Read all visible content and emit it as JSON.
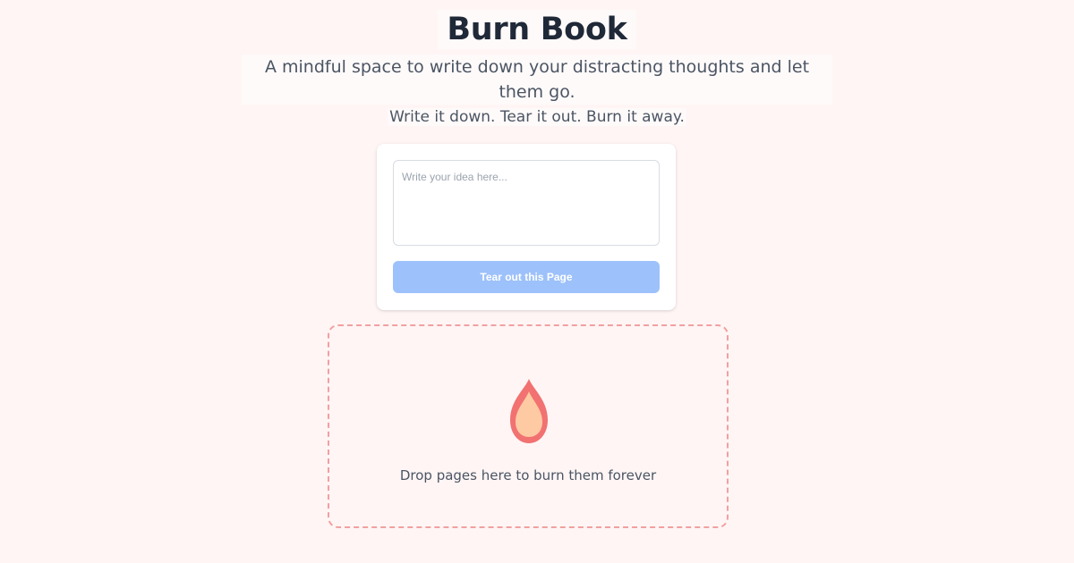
{
  "header": {
    "title": "Burn Book",
    "subtitle": "A mindful space to write down your distracting thoughts and let them go.",
    "tagline": "Write it down. Tear it out. Burn it away."
  },
  "editor": {
    "placeholder": "Write your idea here...",
    "value": "",
    "button_label": "Tear out this Page"
  },
  "drop_zone": {
    "icon": "flame-icon",
    "text": "Drop pages here to burn them forever"
  },
  "colors": {
    "background": "#fff5f5",
    "button": "#9dc1fa",
    "drop_border": "#f2a0a0",
    "flame_outer": "#f27171",
    "flame_inner": "#fdcaa3"
  }
}
